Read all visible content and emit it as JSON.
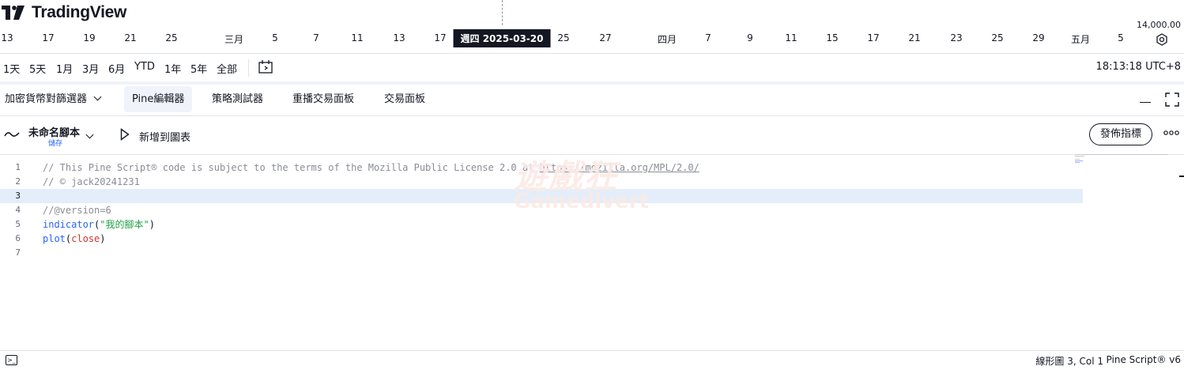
{
  "brand": {
    "name": "TradingView"
  },
  "price_scale": {
    "label": "14,000.00"
  },
  "date_axis": {
    "labels": [
      "13",
      "17",
      "19",
      "21",
      "25",
      "三月",
      "5",
      "7",
      "11",
      "13",
      "17",
      "25",
      "27",
      "四月",
      "7",
      "9",
      "11",
      "15",
      "17",
      "21",
      "23",
      "25",
      "29",
      "五月",
      "5"
    ],
    "highlight": "週四 2025-03-20"
  },
  "range_bar": {
    "ranges": [
      "1天",
      "5天",
      "1月",
      "3月",
      "6月",
      "YTD",
      "1年",
      "5年",
      "全部"
    ],
    "time": "18:13:18 UTC+8"
  },
  "bottom_tabs": [
    {
      "label": "加密貨幣對篩選器",
      "has_dropdown": true,
      "active": false
    },
    {
      "label": "Pine編輯器",
      "active": true
    },
    {
      "label": "策略測試器",
      "active": false
    },
    {
      "label": "重播交易面板",
      "active": false
    },
    {
      "label": "交易面板",
      "active": false
    }
  ],
  "editor": {
    "script_name": "未命名腳本",
    "save_label": "儲存",
    "add_to_chart": "新增到圖表",
    "publish": "發佈指標",
    "current_line": 3,
    "lines": [
      {
        "n": "1",
        "parts": [
          {
            "t": "// This Pine Script® code is subject to the terms of the Mozilla Public License 2.0 at ",
            "c": "com"
          },
          {
            "t": "https://mozilla.org/MPL/2.0/",
            "c": "url"
          }
        ]
      },
      {
        "n": "2",
        "parts": [
          {
            "t": "// © jack20241231",
            "c": "com"
          }
        ]
      },
      {
        "n": "3",
        "parts": []
      },
      {
        "n": "4",
        "parts": [
          {
            "t": "//@version=6",
            "c": "com"
          }
        ]
      },
      {
        "n": "5",
        "parts": [
          {
            "t": "indicator",
            "c": "fn"
          },
          {
            "t": "(",
            "c": "plain"
          },
          {
            "t": "\"我的腳本\"",
            "c": "str"
          },
          {
            "t": ")",
            "c": "plain"
          }
        ]
      },
      {
        "n": "6",
        "parts": [
          {
            "t": "plot",
            "c": "fn"
          },
          {
            "t": "(",
            "c": "plain"
          },
          {
            "t": "close",
            "c": "var"
          },
          {
            "t": ")",
            "c": "plain"
          }
        ]
      },
      {
        "n": "7",
        "parts": []
      }
    ]
  },
  "watermark": {
    "cn": "遊戲狂",
    "en": "Gamedivert"
  },
  "status": {
    "position": "線形圖 3, Col 1",
    "version": "Pine Script® v6"
  },
  "colors": {
    "accent": "#2962ff",
    "highlight_line": "#e3eefa",
    "comment": "#8a8d96",
    "string": "#22a148",
    "variable": "#d0342c"
  },
  "icons": [
    "tradingview-logo-icon",
    "settings-icon",
    "compare-icon",
    "chevron-down-icon",
    "minimize-icon",
    "maximize-icon",
    "indicator-wave-icon",
    "play-icon",
    "more-icon",
    "console-icon"
  ]
}
